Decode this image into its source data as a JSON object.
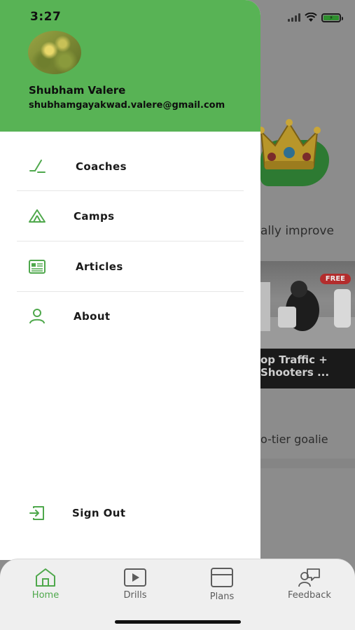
{
  "status_bar": {
    "time": "3:27"
  },
  "background": {
    "text_1": "ally improve",
    "video": {
      "badge": "FREE",
      "title_line_1": "op Traffic +",
      "title_line_2": "Shooters ..."
    },
    "text_2": "o-tier goalie"
  },
  "drawer": {
    "user": {
      "name": "Shubham Valere",
      "email": "shubhamgayakwad.valere@gmail.com"
    },
    "menu": [
      {
        "label": "Coaches",
        "icon": "hockey-stick-icon"
      },
      {
        "label": "Camps",
        "icon": "tent-icon"
      },
      {
        "label": "Articles",
        "icon": "newspaper-icon"
      },
      {
        "label": "About",
        "icon": "person-icon"
      }
    ],
    "sign_out": {
      "label": "Sign Out",
      "icon": "sign-out-icon"
    }
  },
  "tabbar": {
    "tabs": [
      {
        "label": "Home",
        "icon": "home-icon",
        "active": true
      },
      {
        "label": "Drills",
        "icon": "play-icon",
        "active": false
      },
      {
        "label": "Plans",
        "icon": "plans-icon",
        "active": false
      },
      {
        "label": "Feedback",
        "icon": "feedback-icon",
        "active": false
      }
    ]
  },
  "colors": {
    "accent_green": "#58b355",
    "icon_green": "#4fa84c",
    "free_badge": "#b32d2d"
  }
}
